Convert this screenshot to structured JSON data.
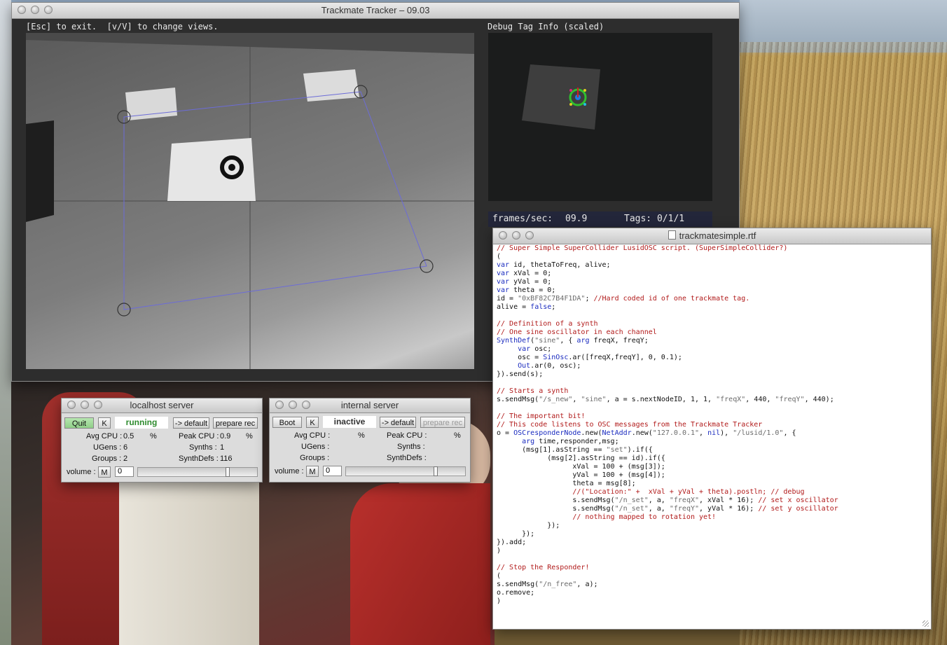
{
  "tracker": {
    "title": "Trackmate Tracker – 09.03",
    "hint": "[Esc] to exit.  [v/V] to change views.",
    "debug_title": "Debug Tag Info (scaled)",
    "fps_label": "frames/sec:",
    "fps_value": "09.9",
    "tags_label": "Tags: 0/1/1"
  },
  "localhost": {
    "title": "localhost server",
    "quit": "Quit",
    "k": "K",
    "status": "running",
    "default": "-> default",
    "prepare": "prepare rec",
    "avg_cpu_label": "Avg CPU :",
    "avg_cpu": "0.5",
    "peak_cpu_label": "Peak CPU :",
    "peak_cpu": "0.9",
    "pct": "%",
    "ugens_label": "UGens :",
    "ugens": "6",
    "synths_label": "Synths :",
    "synths": "1",
    "groups_label": "Groups :",
    "groups": "2",
    "synthdefs_label": "SynthDefs :",
    "synthdefs": "116",
    "volume_label": "volume :",
    "mute": "M",
    "volume": "0",
    "volume_level": 0.75
  },
  "internal": {
    "title": "internal server",
    "boot": "Boot",
    "k": "K",
    "status": "inactive",
    "default": "-> default",
    "prepare": "prepare rec",
    "avg_cpu_label": "Avg CPU :",
    "peak_cpu_label": "Peak CPU :",
    "pct": "%",
    "ugens_label": "UGens :",
    "synths_label": "Synths :",
    "groups_label": "Groups :",
    "synthdefs_label": "SynthDefs :",
    "volume_label": "volume :",
    "mute": "M",
    "volume": "0",
    "volume_level": 0.75
  },
  "editor": {
    "title": "trackmatesimple.rtf",
    "lines": [
      [
        [
          "// Super Simple SuperCollider LusidOSC script. (SuperSimpleCollider?)",
          "com"
        ]
      ],
      [
        [
          "(",
          ""
        ]
      ],
      [
        [
          "var",
          "kw"
        ],
        [
          " id, thetaToFreq, alive;",
          ""
        ]
      ],
      [
        [
          "var",
          "kw"
        ],
        [
          " xVal = 0;",
          ""
        ]
      ],
      [
        [
          "var",
          "kw"
        ],
        [
          " yVal = 0;",
          ""
        ]
      ],
      [
        [
          "var",
          "kw"
        ],
        [
          " theta = 0;",
          ""
        ]
      ],
      [
        [
          "id = ",
          ""
        ],
        [
          "\"0xBF82C7B4F1DA\"",
          "str"
        ],
        [
          "; ",
          ""
        ],
        [
          "//Hard coded id of one trackmate tag.",
          "com"
        ]
      ],
      [
        [
          "alive = ",
          ""
        ],
        [
          "false",
          "kw"
        ],
        [
          ";",
          ""
        ]
      ],
      [
        [
          "",
          ""
        ]
      ],
      [
        [
          "// Definition of a synth",
          "com"
        ]
      ],
      [
        [
          "// One sine oscillator in each channel",
          "com"
        ]
      ],
      [
        [
          "SynthDef",
          "cls"
        ],
        [
          "(",
          ""
        ],
        [
          "\"sine\"",
          "str"
        ],
        [
          ", { ",
          ""
        ],
        [
          "arg",
          "kw"
        ],
        [
          " freqX, freqY;",
          ""
        ]
      ],
      [
        [
          "     ",
          ""
        ],
        [
          "var",
          "kw"
        ],
        [
          " osc;",
          ""
        ]
      ],
      [
        [
          "     osc = ",
          ""
        ],
        [
          "SinOsc",
          "cls"
        ],
        [
          ".ar([freqX,freqY], 0, 0.1);",
          ""
        ]
      ],
      [
        [
          "     ",
          ""
        ],
        [
          "Out",
          "cls"
        ],
        [
          ".ar(0, osc);",
          ""
        ]
      ],
      [
        [
          "}).send(s);",
          ""
        ]
      ],
      [
        [
          "",
          ""
        ]
      ],
      [
        [
          "// Starts a synth",
          "com"
        ]
      ],
      [
        [
          "s.sendMsg(",
          ""
        ],
        [
          "\"/s_new\"",
          "str"
        ],
        [
          ", ",
          ""
        ],
        [
          "\"sine\"",
          "str"
        ],
        [
          ", a = s.nextNodeID, 1, 1, ",
          ""
        ],
        [
          "\"freqX\"",
          "str"
        ],
        [
          ", 440, ",
          ""
        ],
        [
          "\"freqY\"",
          "str"
        ],
        [
          ", 440);",
          ""
        ]
      ],
      [
        [
          "",
          ""
        ]
      ],
      [
        [
          "// The important bit!",
          "com"
        ]
      ],
      [
        [
          "// This code listens to OSC messages from the Trackmate Tracker",
          "com"
        ]
      ],
      [
        [
          "o = ",
          ""
        ],
        [
          "OSCresponderNode",
          "cls"
        ],
        [
          ".new(",
          ""
        ],
        [
          "NetAddr",
          "cls"
        ],
        [
          ".new(",
          ""
        ],
        [
          "\"127.0.0.1\"",
          "str"
        ],
        [
          ", ",
          ""
        ],
        [
          "nil",
          "kw"
        ],
        [
          "), ",
          ""
        ],
        [
          "\"/lusid/1.0\"",
          "str"
        ],
        [
          ", {",
          ""
        ]
      ],
      [
        [
          "      ",
          ""
        ],
        [
          "arg",
          "kw"
        ],
        [
          " time,responder,msg;",
          ""
        ]
      ],
      [
        [
          "      (msg[1].asString == ",
          ""
        ],
        [
          "\"set\"",
          "str"
        ],
        [
          ").if({",
          ""
        ]
      ],
      [
        [
          "            (msg[2].asString == id).if({",
          ""
        ]
      ],
      [
        [
          "                  xVal = 100 + (msg[3]);",
          ""
        ]
      ],
      [
        [
          "                  yVal = 100 + (msg[4]);",
          ""
        ]
      ],
      [
        [
          "                  theta = msg[8];",
          ""
        ]
      ],
      [
        [
          "                  ",
          ""
        ],
        [
          "//(\"Location:\" +  xVal + yVal + theta).postln; // debug",
          "com"
        ]
      ],
      [
        [
          "                  s.sendMsg(",
          ""
        ],
        [
          "\"/n_set\"",
          "str"
        ],
        [
          ", a, ",
          ""
        ],
        [
          "\"freqX\"",
          "str"
        ],
        [
          ", xVal * 16); ",
          ""
        ],
        [
          "// set x oscillator",
          "com"
        ]
      ],
      [
        [
          "                  s.sendMsg(",
          ""
        ],
        [
          "\"/n_set\"",
          "str"
        ],
        [
          ", a, ",
          ""
        ],
        [
          "\"freqY\"",
          "str"
        ],
        [
          ", yVal * 16); ",
          ""
        ],
        [
          "// set y oscillator",
          "com"
        ]
      ],
      [
        [
          "                  ",
          ""
        ],
        [
          "// nothing mapped to rotation yet!",
          "com"
        ]
      ],
      [
        [
          "            });",
          ""
        ]
      ],
      [
        [
          "      });",
          ""
        ]
      ],
      [
        [
          "}).add;",
          ""
        ]
      ],
      [
        [
          ")",
          ""
        ]
      ],
      [
        [
          "",
          ""
        ]
      ],
      [
        [
          "// Stop the Responder!",
          "com"
        ]
      ],
      [
        [
          "(",
          ""
        ]
      ],
      [
        [
          "s.sendMsg(",
          ""
        ],
        [
          "\"/n_free\"",
          "str"
        ],
        [
          ", a);",
          ""
        ]
      ],
      [
        [
          "o.remove;",
          ""
        ]
      ],
      [
        [
          ")",
          ""
        ]
      ]
    ]
  }
}
